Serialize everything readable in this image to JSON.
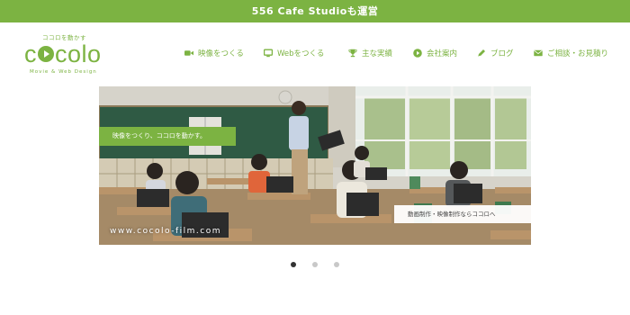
{
  "topbar": {
    "text": "556 Cafe Studioも運営"
  },
  "logo": {
    "tagline": "ココロを動かす",
    "word_before": "c",
    "word_after": "colo",
    "subtitle": "Movie & Web Design"
  },
  "nav": {
    "items": [
      {
        "label": "映像をつくる",
        "icon": "video-camera-icon"
      },
      {
        "label": "Webをつくる",
        "icon": "monitor-icon"
      },
      {
        "label": "主な実績",
        "icon": "trophy-icon"
      },
      {
        "label": "会社案内",
        "icon": "play-circle-icon"
      },
      {
        "label": "ブログ",
        "icon": "pen-icon"
      },
      {
        "label": "ご相談・お見積り",
        "icon": "envelope-icon"
      }
    ]
  },
  "hero": {
    "caption_primary": "映像をつくり、ココロを動かす。",
    "caption_secondary": "動画制作・映像制作ならココロへ",
    "url": "www.cocolo-film.com"
  },
  "carousel": {
    "slide_count": 3,
    "active_index": 0
  },
  "colors": {
    "brand_green": "#7cb342"
  }
}
